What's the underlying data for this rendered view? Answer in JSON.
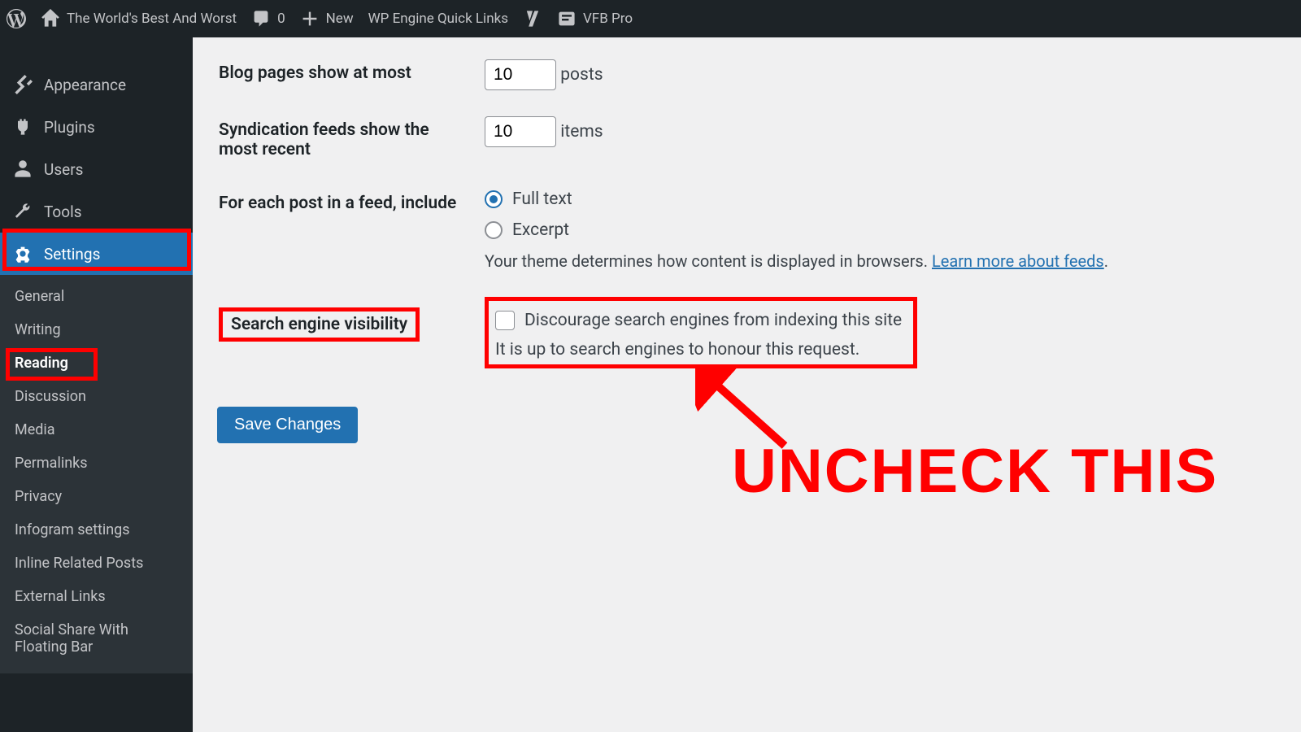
{
  "adminbar": {
    "site_title": "The World's Best And Worst",
    "comments_count": "0",
    "new_label": "New",
    "wpengine_label": "WP Engine Quick Links",
    "vfb_label": "VFB Pro"
  },
  "sidebar": {
    "appearance": "Appearance",
    "plugins": "Plugins",
    "users": "Users",
    "tools": "Tools",
    "settings": "Settings",
    "submenu": {
      "general": "General",
      "writing": "Writing",
      "reading": "Reading",
      "discussion": "Discussion",
      "media": "Media",
      "permalinks": "Permalinks",
      "privacy": "Privacy",
      "infogram": "Infogram settings",
      "inline_related": "Inline Related Posts",
      "external_links": "External Links",
      "social_share": "Social Share With Floating Bar"
    }
  },
  "settings_page": {
    "blog_pages_label": "Blog pages show at most",
    "blog_pages_value": "10",
    "blog_pages_suffix": "posts",
    "synd_label": "Syndication feeds show the most recent",
    "synd_value": "10",
    "synd_suffix": "items",
    "feed_include_label": "For each post in a feed, include",
    "feed_full_text": "Full text",
    "feed_excerpt": "Excerpt",
    "feed_desc": "Your theme determines how content is displayed in browsers. ",
    "feed_learn_more": "Learn more about feeds",
    "sev_label": "Search engine visibility",
    "sev_checkbox_label": "Discourage search engines from indexing this site",
    "sev_desc": "It is up to search engines to honour this request.",
    "save_button": "Save Changes"
  },
  "annotation": {
    "text": "UNCHECK THIS"
  }
}
